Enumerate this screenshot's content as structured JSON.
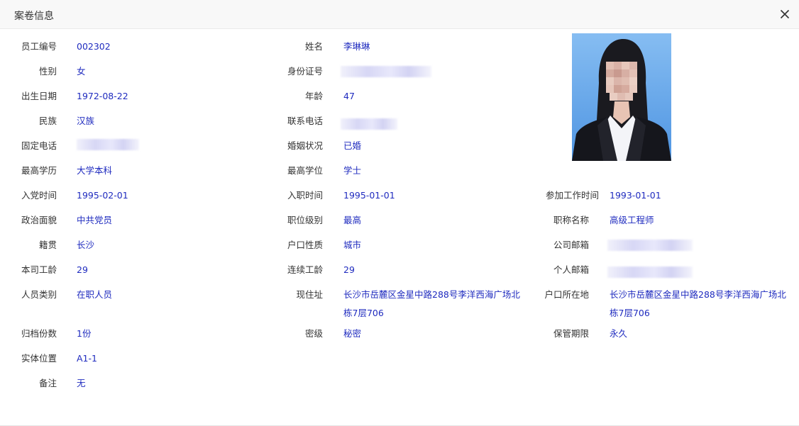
{
  "dialog": {
    "title": "案卷信息",
    "close_icon": "close-icon"
  },
  "photo": {
    "alt": "员工照片"
  },
  "fields": {
    "emp_no": {
      "label": "员工编号",
      "value": "002302"
    },
    "name": {
      "label": "姓名",
      "value": "李琳琳"
    },
    "gender": {
      "label": "性别",
      "value": "女"
    },
    "id_card": {
      "label": "身份证号",
      "value": ""
    },
    "birth_date": {
      "label": "出生日期",
      "value": "1972-08-22"
    },
    "age": {
      "label": "年龄",
      "value": "47"
    },
    "ethnicity": {
      "label": "民族",
      "value": "汉族"
    },
    "phone": {
      "label": "联系电话",
      "value": ""
    },
    "landline": {
      "label": "固定电话",
      "value": ""
    },
    "marital": {
      "label": "婚姻状况",
      "value": "已婚"
    },
    "education": {
      "label": "最高学历",
      "value": "大学本科"
    },
    "degree": {
      "label": "最高学位",
      "value": "学士"
    },
    "party_date": {
      "label": "入党时间",
      "value": "1995-02-01"
    },
    "hire_date": {
      "label": "入职时间",
      "value": "1995-01-01"
    },
    "work_start": {
      "label": "参加工作时间",
      "value": "1993-01-01"
    },
    "political": {
      "label": "政治面貌",
      "value": "中共党员"
    },
    "job_level": {
      "label": "职位级别",
      "value": "最高"
    },
    "title_name": {
      "label": "职称名称",
      "value": "高级工程师"
    },
    "native": {
      "label": "籍贯",
      "value": "长沙"
    },
    "hukou_type": {
      "label": "户口性质",
      "value": "城市"
    },
    "work_email": {
      "label": "公司邮箱",
      "value": ""
    },
    "company_years": {
      "label": "本司工龄",
      "value": "29"
    },
    "continuous_years": {
      "label": "连续工龄",
      "value": "29"
    },
    "personal_email": {
      "label": "个人邮箱",
      "value": ""
    },
    "staff_type": {
      "label": "人员类别",
      "value": "在职人员"
    },
    "address": {
      "label": "现住址",
      "value": "长沙市岳麓区金星中路288号李洋西海广场北栋7层706"
    },
    "hukou_addr": {
      "label": "户口所在地",
      "value": "长沙市岳麓区金星中路288号李洋西海广场北栋7层706"
    },
    "copies": {
      "label": "归档份数",
      "value": "1份"
    },
    "secret": {
      "label": "密级",
      "value": "秘密"
    },
    "retention": {
      "label": "保管期限",
      "value": "永久"
    },
    "location": {
      "label": "实体位置",
      "value": "A1-1"
    },
    "remark": {
      "label": "备注",
      "value": "无"
    }
  }
}
